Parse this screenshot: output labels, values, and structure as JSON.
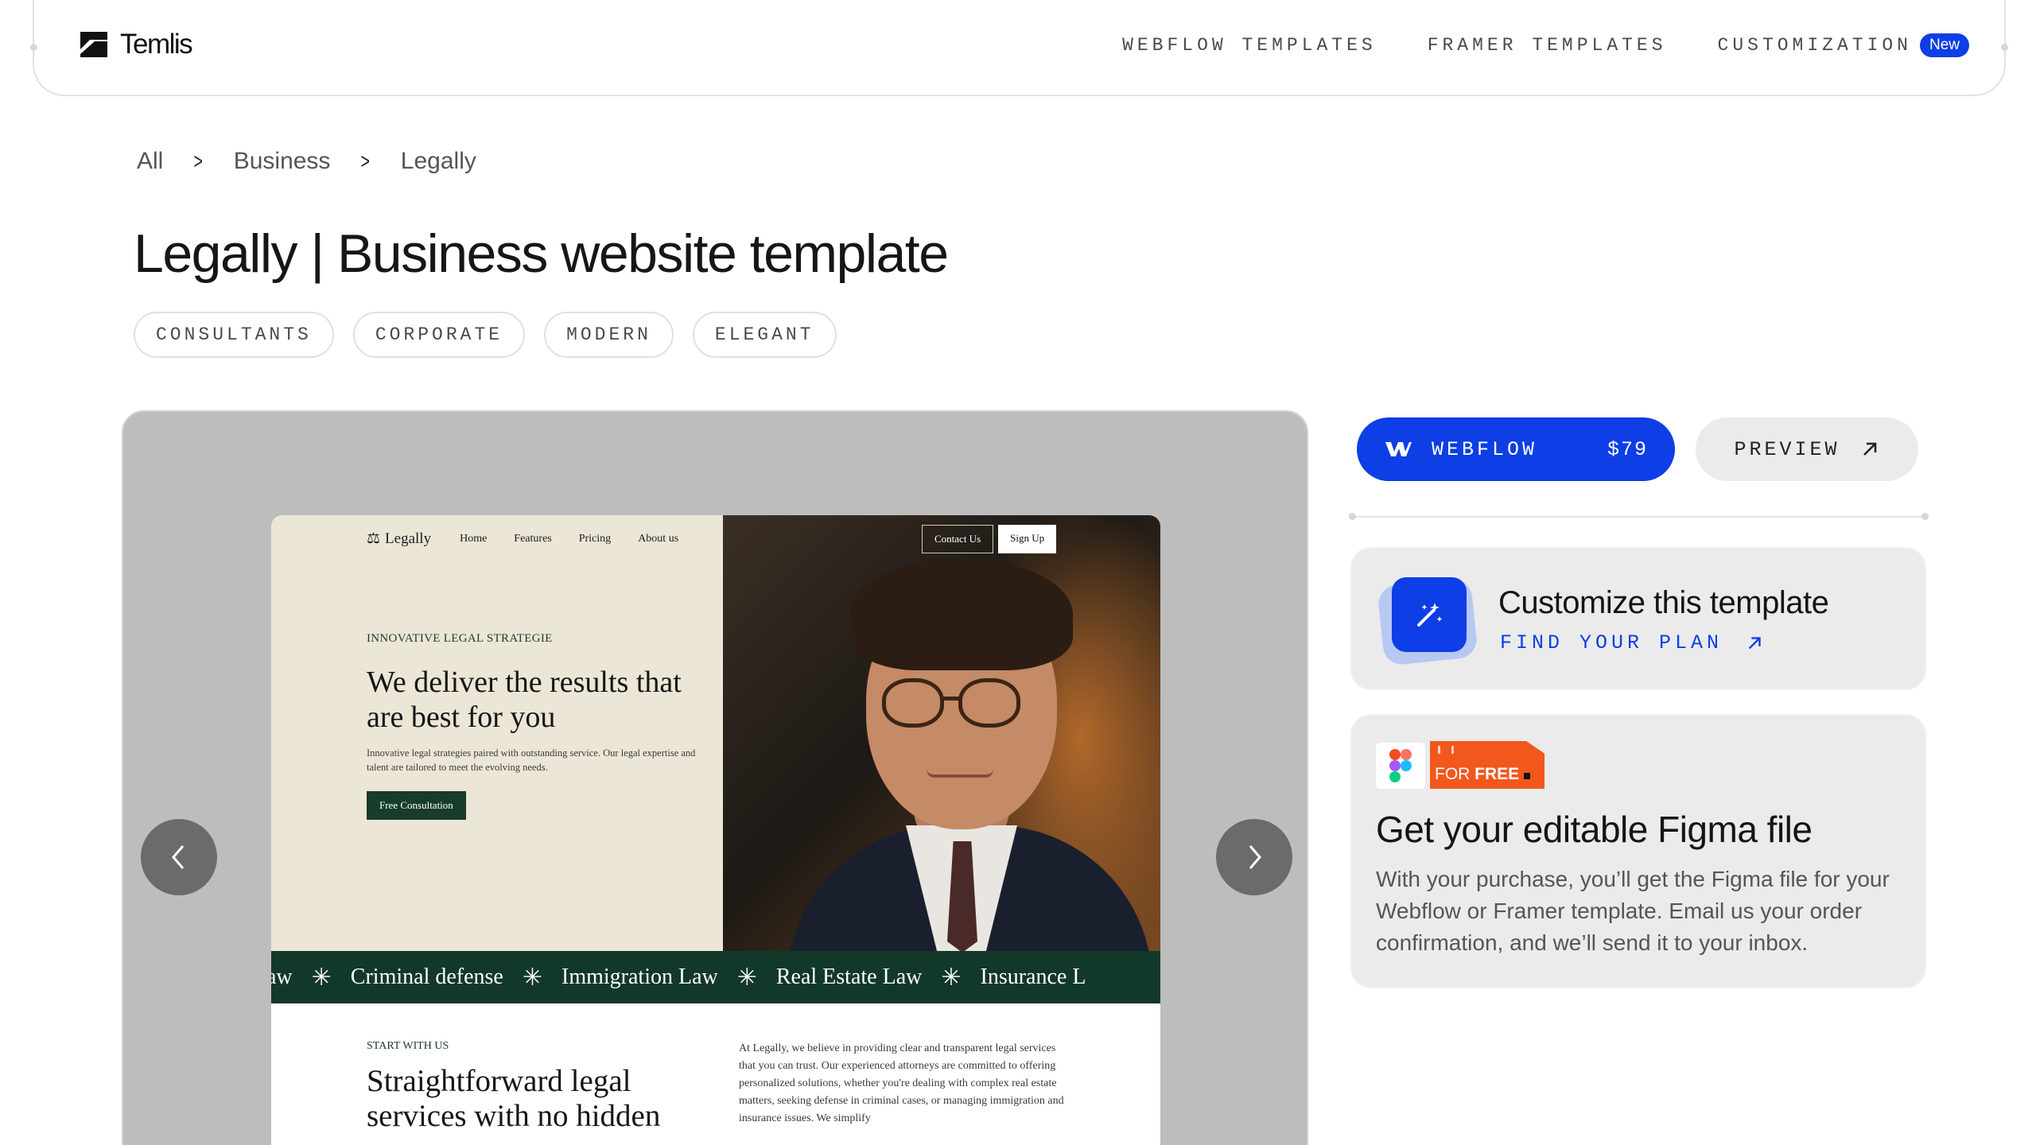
{
  "header": {
    "brand": "Temlis",
    "nav": [
      {
        "label": "WEBFLOW TEMPLATES"
      },
      {
        "label": "FRAMER TEMPLATES"
      },
      {
        "label": "CUSTOMIZATION",
        "badge": "New"
      }
    ]
  },
  "breadcrumb": [
    "All",
    "Business",
    "Legally"
  ],
  "page_title": "Legally | Business website template",
  "tags": [
    "CONSULTANTS",
    "CORPORATE",
    "MODERN",
    "ELEGANT"
  ],
  "preview": {
    "site": {
      "logo": "Legally",
      "nav": [
        "Home",
        "Features",
        "Pricing",
        "About us"
      ],
      "contact_btn": "Contact Us",
      "signup_btn": "Sign Up",
      "eyebrow": "INNOVATIVE LEGAL STRATEGIE",
      "headline": "We deliver the results that are best for you",
      "subtext": "Innovative legal strategies paired with outstanding service. Our legal expertise and talent are tailored to meet the evolving needs.",
      "cta": "Free Consultation",
      "band": [
        "aw",
        "Criminal defense",
        "Immigration Law",
        "Real Estate Law",
        "Insurance L"
      ],
      "lower_eyebrow": "START WITH US",
      "lower_headline": "Straightforward legal services with no hidden",
      "lower_body": "At Legally, we believe in providing clear and transparent legal services that you can trust. Our experienced attorneys are committed to offering personalized solutions, whether you're dealing with complex real estate matters, seeking defense in criminal cases, or managing immigration and insurance issues. We simplify"
    },
    "prev_icon": "chevron-left-icon",
    "next_icon": "chevron-right-icon"
  },
  "purchase": {
    "webflow_label": "WEBFLOW",
    "price": "$79",
    "preview_label": "PREVIEW"
  },
  "customize_card": {
    "title": "Customize this template",
    "link": "FIND YOUR PLAN"
  },
  "figma_card": {
    "tag_text_1": "FOR",
    "tag_text_2": "FREE",
    "title": "Get your editable Figma file",
    "body": "With your purchase, you’ll get the Figma file for your Webflow or Framer template. Email us your order confirmation, and we’ll send it to your inbox."
  },
  "colors": {
    "accent": "#0d3ee6",
    "orange": "#f2571c",
    "band_green": "#12382a"
  }
}
